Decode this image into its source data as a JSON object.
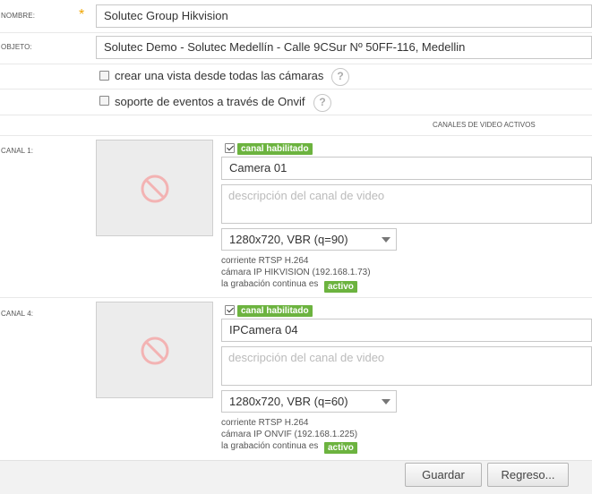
{
  "form": {
    "name_label": "NOMBRE:",
    "name_required_mark": "*",
    "name_value": "Solutec Group Hikvision",
    "object_label": "OBJETO:",
    "object_value": "Solutec Demo - Solutec Medellín - Calle 9CSur Nº 50FF-116, Medellin",
    "options": [
      {
        "label": "crear una vista desde todas las cámaras",
        "checked": false,
        "help": "?"
      },
      {
        "label": "soporte de eventos a través de Onvif",
        "checked": false,
        "help": "?"
      }
    ]
  },
  "channels_section_title": "CANALES DE VIDEO ACTIVOS",
  "channels": [
    {
      "label": "CANAL 1:",
      "enabled": true,
      "enabled_badge": "canal habilitado",
      "name_value": "Camera 01",
      "description_placeholder": "descripción del canal de video",
      "stream_value": "1280x720, VBR (q=90)",
      "info_stream": "corriente RTSP H.264",
      "info_camera": "cámara IP HIKVISION (192.168.1.73)",
      "info_recording": "la grabación continua es",
      "recording_badge": "activo"
    },
    {
      "label": "CANAL 4:",
      "enabled": true,
      "enabled_badge": "canal habilitado",
      "name_value": "IPCamera 04",
      "description_placeholder": "descripción del canal de video",
      "stream_value": "1280x720, VBR (q=60)",
      "info_stream": "corriente RTSP H.264",
      "info_camera": "cámara IP ONVIF (192.168.1.225)",
      "info_recording": "la grabación continua es",
      "recording_badge": "activo"
    }
  ],
  "buttons": {
    "save": "Guardar",
    "back": "Regreso..."
  },
  "colors": {
    "badge_green": "#6cb33f",
    "required_star": "#f0a500",
    "no_image_icon": "#f3b3b3"
  }
}
